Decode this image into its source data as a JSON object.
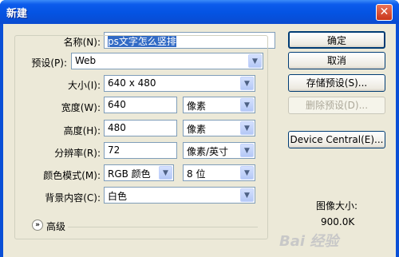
{
  "dialog": {
    "title": "新建",
    "close_glyph": "✕"
  },
  "name": {
    "label": "名称(N):",
    "value": "ps文字怎么竖排"
  },
  "preset": {
    "label": "预设(P):",
    "value": "Web"
  },
  "size": {
    "label": "大小(I):",
    "value": "640 x 480"
  },
  "width": {
    "label": "宽度(W):",
    "value": "640",
    "unit": "像素"
  },
  "height": {
    "label": "高度(H):",
    "value": "480",
    "unit": "像素"
  },
  "resolution": {
    "label": "分辨率(R):",
    "value": "72",
    "unit": "像素/英寸"
  },
  "color_mode": {
    "label": "颜色模式(M):",
    "value": "RGB 颜色",
    "depth": "8 位"
  },
  "background": {
    "label": "背景内容(C):",
    "value": "白色"
  },
  "advanced": {
    "label": "高级",
    "icon": "double-chevron-down-icon"
  },
  "buttons": {
    "ok": "确定",
    "cancel": "取消",
    "save_preset": "存储预设(S)...",
    "delete_preset": "删除预设(D)...",
    "device_central": "Device Central(E)..."
  },
  "image_size": {
    "label": "图像大小:",
    "value": "900.0K"
  },
  "watermark": "Bai 经验"
}
